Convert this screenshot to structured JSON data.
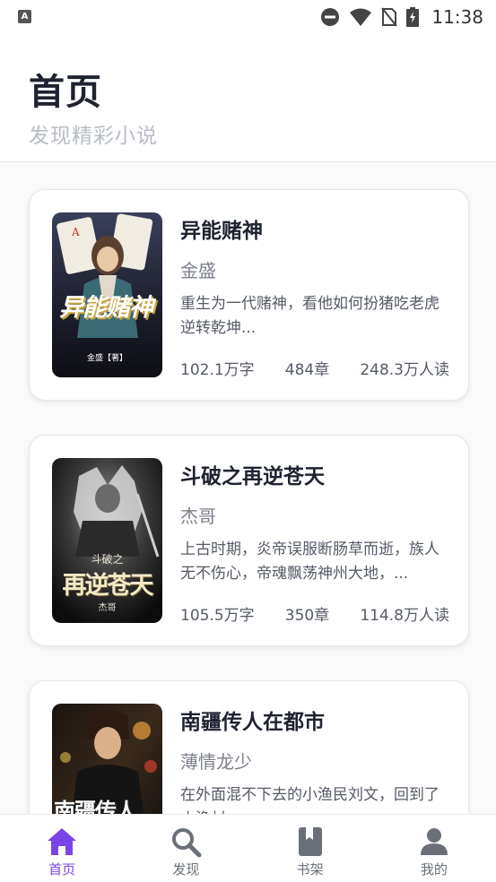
{
  "status_bar": {
    "time": "11:38",
    "app_icon_text": "A"
  },
  "header": {
    "title": "首页",
    "subtitle": "发现精彩小说"
  },
  "books": [
    {
      "title": "异能赌神",
      "author": "金盛",
      "description": "重生为一代赌神，看他如何扮猪吃老虎逆转乾坤...",
      "words": "102.1万字",
      "chapters": "484章",
      "readers": "248.3万人读",
      "cover_title": "异能赌神",
      "cover_credit": "金盛【著】"
    },
    {
      "title": "斗破之再逆苍天",
      "author": "杰哥",
      "description": "上古时期，炎帝误服断肠草而逝，族人无不伤心，帝魂飘荡神州大地，...",
      "words": "105.5万字",
      "chapters": "350章",
      "readers": "114.8万人读",
      "cover_title": "再逆苍天",
      "cover_small": "斗破之",
      "cover_credit": "杰哥"
    },
    {
      "title": "南疆传人在都市",
      "author": "薄情龙少",
      "description": "在外面混不下去的小渔民刘文，回到了小渔村...",
      "cover_title": "南疆传人"
    }
  ],
  "nav": [
    {
      "label": "首页",
      "icon": "home-icon",
      "active": true
    },
    {
      "label": "发现",
      "icon": "search-icon",
      "active": false
    },
    {
      "label": "书架",
      "icon": "bookshelf-icon",
      "active": false
    },
    {
      "label": "我的",
      "icon": "profile-icon",
      "active": false
    }
  ],
  "colors": {
    "accent": "#7a45e6",
    "inactive": "#6b6f78",
    "title": "#1f2330",
    "subtitle": "#b8bcc6"
  }
}
